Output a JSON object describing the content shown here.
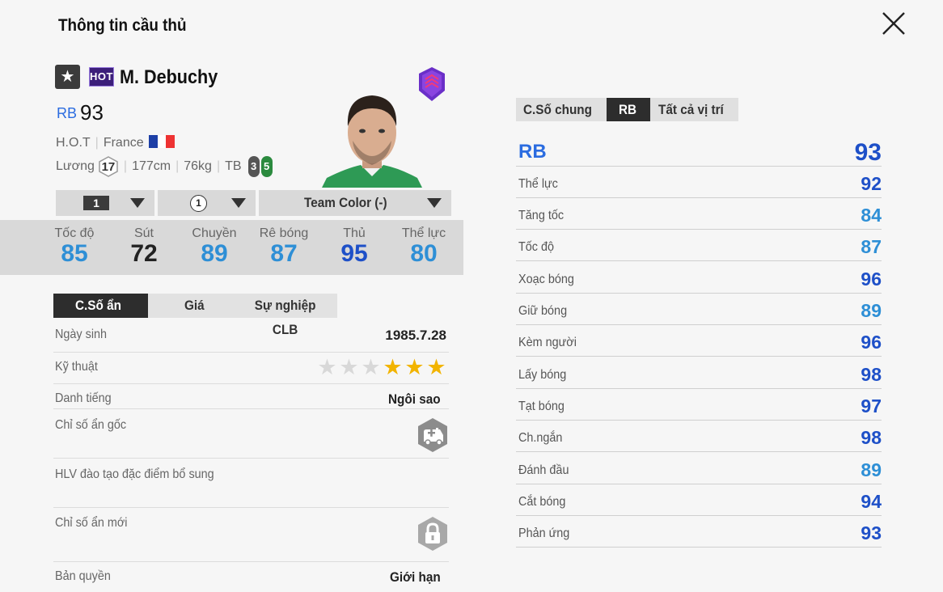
{
  "page": {
    "title": "Thông tin cầu thủ"
  },
  "player": {
    "season_badge": "HOT",
    "name": "M. Debuchy",
    "position": "RB",
    "overall": "93",
    "season": "H.O.T",
    "nation": "France",
    "salary_label": "Lương",
    "salary": "17",
    "height": "177cm",
    "weight": "76kg",
    "body_type": "TB",
    "weak_foot_left": "3",
    "weak_foot_right": "5"
  },
  "selectors": {
    "level": "1",
    "upgrade": "1",
    "team_color": "Team Color (-)"
  },
  "summary_stats": [
    {
      "label": "Tốc độ",
      "value": "85",
      "color": "#2e8fd6"
    },
    {
      "label": "Sút",
      "value": "72",
      "color": "#222222"
    },
    {
      "label": "Chuyền",
      "value": "89",
      "color": "#2e8fd6"
    },
    {
      "label": "Rê bóng",
      "value": "87",
      "color": "#2e8fd6"
    },
    {
      "label": "Thủ",
      "value": "95",
      "color": "#1e50c8"
    },
    {
      "label": "Thể lực",
      "value": "80",
      "color": "#2e8fd6"
    }
  ],
  "left_tabs": [
    {
      "label": "C.Số ẩn",
      "active": true
    },
    {
      "label": "Giá",
      "active": false
    },
    {
      "label": "Sự nghiệp CLB",
      "active": false
    }
  ],
  "hidden_info": {
    "birth_label": "Ngày sinh",
    "birth_value": "1985.7.28",
    "skill_label": "Kỹ thuật",
    "skill_stars": 3,
    "skill_stars_max": 6,
    "fame_label": "Danh tiếng",
    "fame_value": "Ngôi sao",
    "orig_traits_label": "Chỉ số ẩn gốc",
    "coach_traits_label": "HLV đào tạo đặc điểm bổ sung",
    "new_traits_label": "Chỉ số ẩn mới",
    "license_label": "Bản quyền",
    "license_value": "Giới hạn"
  },
  "right_tabs": [
    {
      "label": "C.Số chung",
      "active": false
    },
    {
      "label": "RB",
      "active": true
    },
    {
      "label": "Tất cả vị trí",
      "active": false
    }
  ],
  "position_rating": {
    "label": "RB",
    "value": "93"
  },
  "attributes": [
    {
      "label": "Thể lực",
      "value": "92",
      "color": "#1e50c8"
    },
    {
      "label": "Tăng tốc",
      "value": "84",
      "color": "#2e8fd6"
    },
    {
      "label": "Tốc độ",
      "value": "87",
      "color": "#2e8fd6"
    },
    {
      "label": "Xoạc bóng",
      "value": "96",
      "color": "#1e50c8"
    },
    {
      "label": "Giữ bóng",
      "value": "89",
      "color": "#2e8fd6"
    },
    {
      "label": "Kèm người",
      "value": "96",
      "color": "#1e50c8"
    },
    {
      "label": "Lấy bóng",
      "value": "98",
      "color": "#1e50c8"
    },
    {
      "label": "Tạt bóng",
      "value": "97",
      "color": "#1e50c8"
    },
    {
      "label": "Ch.ngắn",
      "value": "98",
      "color": "#1e50c8"
    },
    {
      "label": "Đánh đầu",
      "value": "89",
      "color": "#2e8fd6"
    },
    {
      "label": "Cắt bóng",
      "value": "94",
      "color": "#1e50c8"
    },
    {
      "label": "Phản ứng",
      "value": "93",
      "color": "#1e50c8"
    }
  ],
  "icons": {
    "close": "close-icon",
    "class_star": "star-icon",
    "club": "club-crest-icon",
    "orig_trait": "ambulance-trait-icon",
    "new_trait": "lock-icon"
  }
}
